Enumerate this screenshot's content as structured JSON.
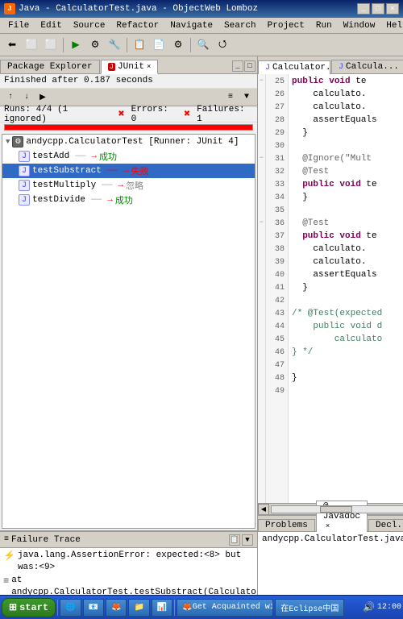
{
  "titleBar": {
    "title": "Java - CalculatorTest.java - ObjectWeb Lomboz",
    "icon": "J"
  },
  "menuBar": {
    "items": [
      "File",
      "Edit",
      "Source",
      "Refactor",
      "Navigate",
      "Search",
      "Project",
      "Run",
      "Window",
      "Help"
    ]
  },
  "leftPanel": {
    "packageExplorer": {
      "label": "Package Explorer"
    },
    "tabs": [
      {
        "label": "Package Explorer",
        "active": false
      },
      {
        "label": "JUnit",
        "active": true
      }
    ],
    "junitStatus": "Finished after 0.187 seconds",
    "junitStats": {
      "runs": "Runs: 4/4 (1 ignored)",
      "errors": "Errors: 0",
      "failures": "Failures: 1"
    },
    "testSuite": {
      "label": "andycpp.CalculatorTest [Runner: JUnit 4]",
      "tests": [
        {
          "name": "testAdd",
          "result": "成功",
          "status": "pass"
        },
        {
          "name": "testSubstract",
          "result": "失败",
          "status": "fail",
          "selected": true
        },
        {
          "name": "testMultiply",
          "result": "忽略",
          "status": "ignore"
        },
        {
          "name": "testDivide",
          "result": "成功",
          "status": "pass"
        }
      ]
    },
    "failureTrace": {
      "label": "Failure Trace",
      "lines": [
        {
          "type": "error",
          "text": "java.lang.AssertionError: expected:<8> but was:<9>"
        },
        {
          "type": "stack",
          "text": "at andycpp.CalculatorTest.testSubstract(CalculatorTest.ja"
        }
      ]
    }
  },
  "rightPanel": {
    "tabs": [
      {
        "label": "Calculator.java",
        "active": true
      },
      {
        "label": "Calcula...",
        "active": false
      }
    ],
    "code": {
      "lines": [
        {
          "num": 25,
          "text": "    public void te",
          "indent": 2
        },
        {
          "num": 26,
          "text": "        calculato.",
          "indent": 3
        },
        {
          "num": 27,
          "text": "        calculato.",
          "indent": 3
        },
        {
          "num": 28,
          "text": "        assertEquals",
          "indent": 3
        },
        {
          "num": 29,
          "text": "    }",
          "indent": 2
        },
        {
          "num": 30,
          "text": "",
          "indent": 0
        },
        {
          "num": 31,
          "text": "    @Ignore(\"Mult",
          "indent": 2,
          "annot": true
        },
        {
          "num": 32,
          "text": "    @Test",
          "indent": 2,
          "annot": true
        },
        {
          "num": 33,
          "text": "    public void te",
          "indent": 2
        },
        {
          "num": 34,
          "text": "    }",
          "indent": 2
        },
        {
          "num": 35,
          "text": "",
          "indent": 0
        },
        {
          "num": 36,
          "text": "    @Test",
          "indent": 2,
          "annot": true
        },
        {
          "num": 37,
          "text": "    public void te",
          "indent": 2
        },
        {
          "num": 38,
          "text": "        calculato.",
          "indent": 3
        },
        {
          "num": 39,
          "text": "        calculato.",
          "indent": 3
        },
        {
          "num": 40,
          "text": "        assertEquals",
          "indent": 3
        },
        {
          "num": 41,
          "text": "    }",
          "indent": 2
        },
        {
          "num": 42,
          "text": "",
          "indent": 0
        },
        {
          "num": 43,
          "text": "/* @Test(expected",
          "indent": 0,
          "comment": true
        },
        {
          "num": 44,
          "text": "    public void d",
          "indent": 2
        },
        {
          "num": 45,
          "text": "        calculato",
          "indent": 3
        },
        {
          "num": 46,
          "text": "} */",
          "indent": 0,
          "comment": true
        },
        {
          "num": 47,
          "text": "",
          "indent": 0
        },
        {
          "num": 48,
          "text": "}",
          "indent": 0
        },
        {
          "num": 49,
          "text": "",
          "indent": 0
        }
      ]
    }
  },
  "bottomPanel": {
    "tabs": [
      {
        "label": "Problems",
        "active": false
      },
      {
        "label": "@ Javadoc",
        "active": true
      },
      {
        "label": "Decl...",
        "active": false
      }
    ],
    "content": "andycpp.CalculatorTest.java"
  },
  "taskbar": {
    "start": "start",
    "items": [
      {
        "label": "Get Acquainted with t..."
      },
      {
        "label": "在Eclipse中国"
      }
    ]
  }
}
